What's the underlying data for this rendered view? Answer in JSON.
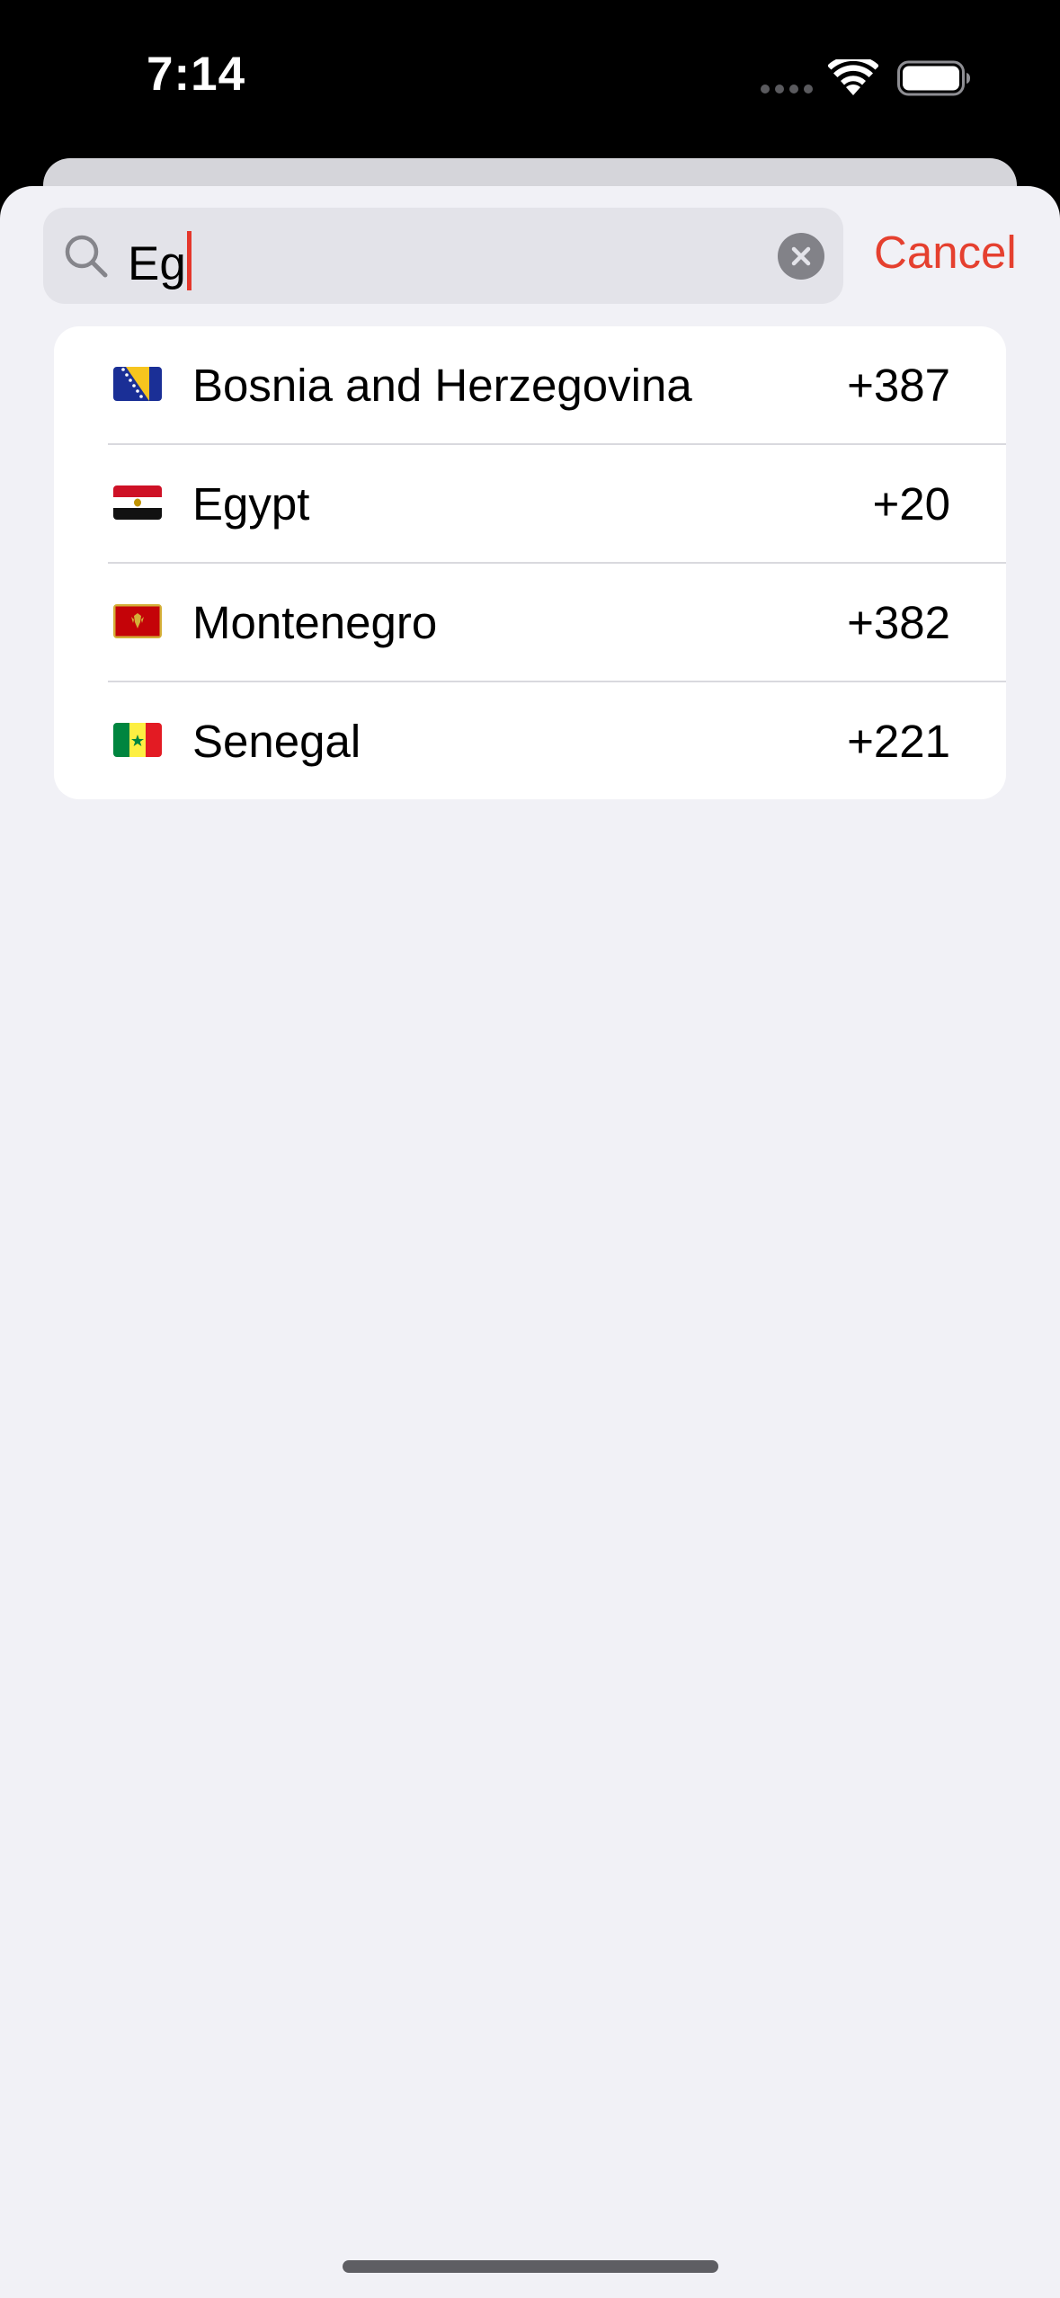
{
  "status_bar": {
    "time": "7:14"
  },
  "search": {
    "value": "Eg",
    "cancel_label": "Cancel",
    "icons": {
      "search": "magnifying-glass-icon",
      "clear": "xmark-circle-icon"
    }
  },
  "results": [
    {
      "flag": "flag-bosnia-and-herzegovina-icon",
      "country": "Bosnia and Herzegovina",
      "code": "+387"
    },
    {
      "flag": "flag-egypt-icon",
      "country": "Egypt",
      "code": "+20"
    },
    {
      "flag": "flag-montenegro-icon",
      "country": "Montenegro",
      "code": "+382"
    },
    {
      "flag": "flag-senegal-icon",
      "country": "Senegal",
      "code": "+221"
    }
  ],
  "colors": {
    "accent": "#e5402f",
    "sheet_background": "#f1f1f6",
    "card_background": "#ffffff",
    "search_field_background": "#e3e3e9"
  }
}
